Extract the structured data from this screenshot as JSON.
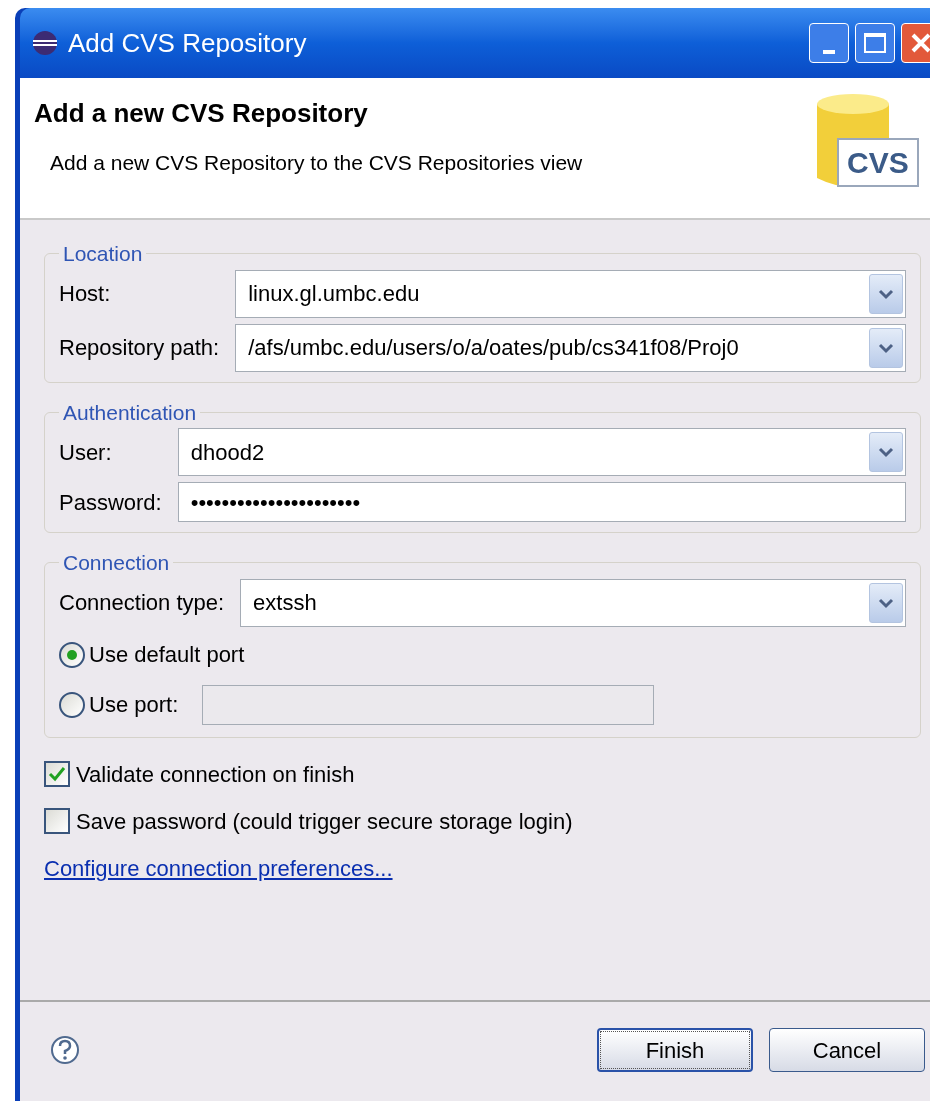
{
  "window": {
    "title": "Add CVS Repository"
  },
  "header": {
    "title": "Add a new CVS Repository",
    "description": "Add a new CVS Repository to the CVS Repositories view",
    "badge": "CVS"
  },
  "groups": [
    {
      "title": "Location",
      "fields": [
        {
          "kind": "combo",
          "label": "Host:",
          "value": "linux.gl.umbc.edu"
        },
        {
          "kind": "combo",
          "label": "Repository path:",
          "value": "/afs/umbc.edu/users/o/a/oates/pub/cs341f08/Proj0"
        }
      ]
    },
    {
      "title": "Authentication",
      "fields": [
        {
          "kind": "combo",
          "label": "User:",
          "value": "dhood2"
        },
        {
          "kind": "password",
          "label": "Password:",
          "value": "••••••••••••••••••••••"
        }
      ]
    },
    {
      "title": "Connection",
      "fields": [
        {
          "kind": "combo",
          "label": "Connection type:",
          "value": "extssh"
        },
        {
          "kind": "radio",
          "label": "Use default port",
          "selected": true
        },
        {
          "kind": "radio_input",
          "label": "Use port:",
          "selected": false,
          "disabled": true
        }
      ]
    }
  ],
  "options": [
    {
      "label": "Validate connection on finish",
      "checked": true
    },
    {
      "label": "Save password (could trigger secure storage login)",
      "checked": false
    }
  ],
  "link": "Configure connection preferences...",
  "buttons": [
    {
      "label": "Finish",
      "default": true
    },
    {
      "label": "Cancel",
      "default": false
    }
  ]
}
